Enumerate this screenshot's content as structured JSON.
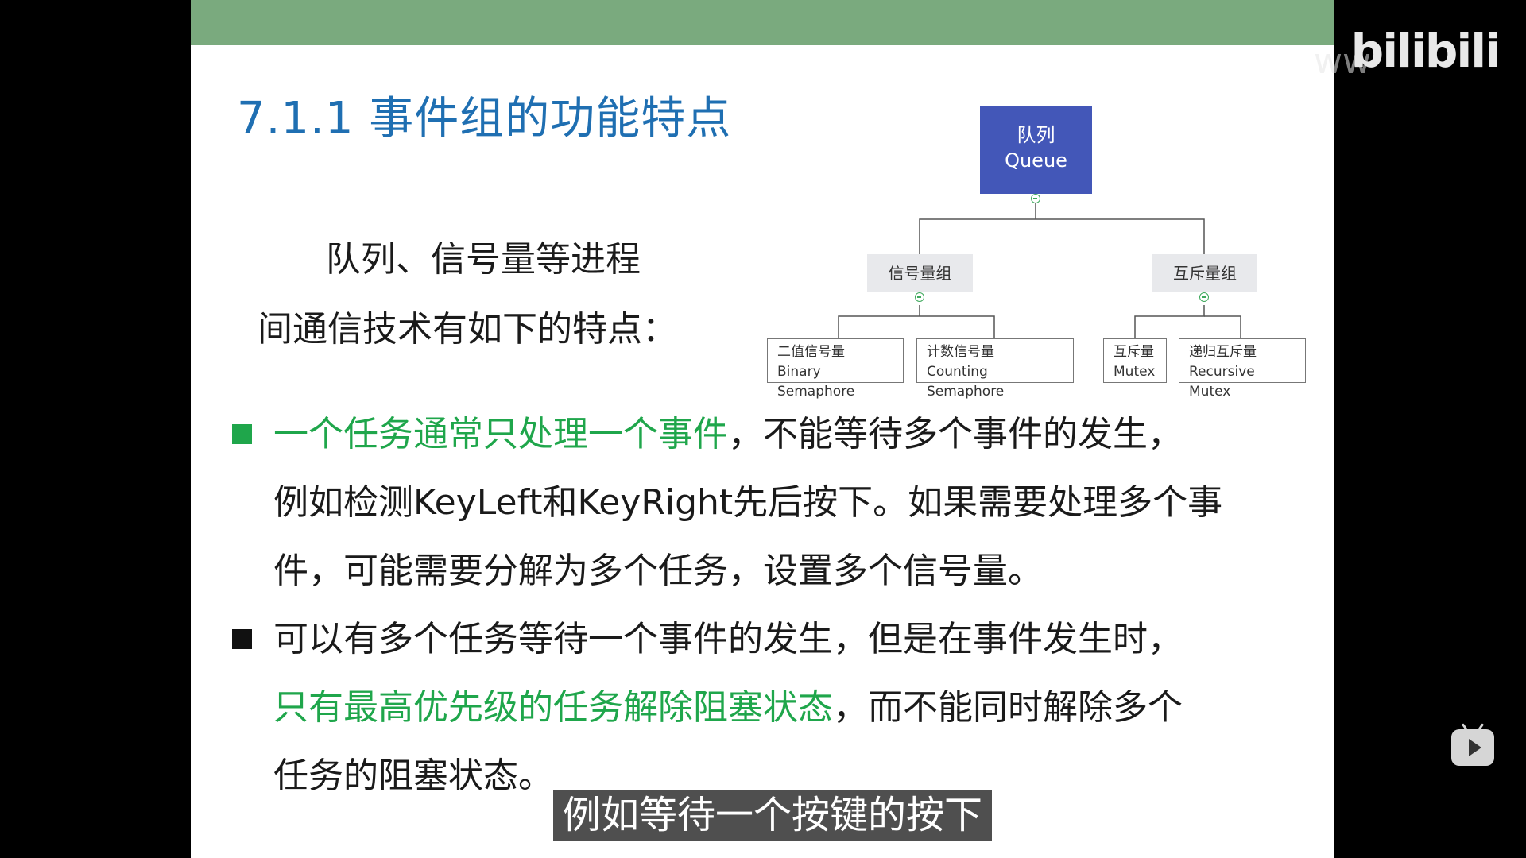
{
  "title": "7.1.1 事件组的功能特点",
  "intro": {
    "line1": "队列、信号量等进程",
    "line2": "间通信技术有如下的特点："
  },
  "diagram": {
    "root": {
      "cn": "队列",
      "en": "Queue"
    },
    "groups": [
      {
        "label": "信号量组",
        "children": [
          {
            "cn": "二值信号量",
            "en": "Binary Semaphore"
          },
          {
            "cn": "计数信号量",
            "en": "Counting Semaphore"
          }
        ]
      },
      {
        "label": "互斥量组",
        "children": [
          {
            "cn": "互斥量",
            "en": "Mutex"
          },
          {
            "cn": "递归互斥量",
            "en": "Recursive Mutex"
          }
        ]
      }
    ]
  },
  "bullets": [
    {
      "highlight": "一个任务通常只处理一个事件",
      "line1_rest": "，不能等待多个事件的发生，",
      "line2": "例如检测KeyLeft和KeyRight先后按下。如果需要处理多个事",
      "line3": "件，可能需要分解为多个任务，设置多个信号量。"
    },
    {
      "line1": "可以有多个任务等待一个事件的发生，但是在事件发生时，",
      "highlight": "只有最高优先级的任务解除阻塞状态",
      "line2_rest": "，而不能同时解除多个",
      "line3": "任务的阻塞状态。"
    }
  ],
  "subtitle": "例如等待一个按键的按下",
  "brand": {
    "logo": "bilibili",
    "ghost": "ww"
  },
  "colors": {
    "title": "#1f6fb2",
    "highlight": "#1fa64b",
    "queue_box": "#4357b8",
    "top_bar": "#7aaa7e"
  }
}
